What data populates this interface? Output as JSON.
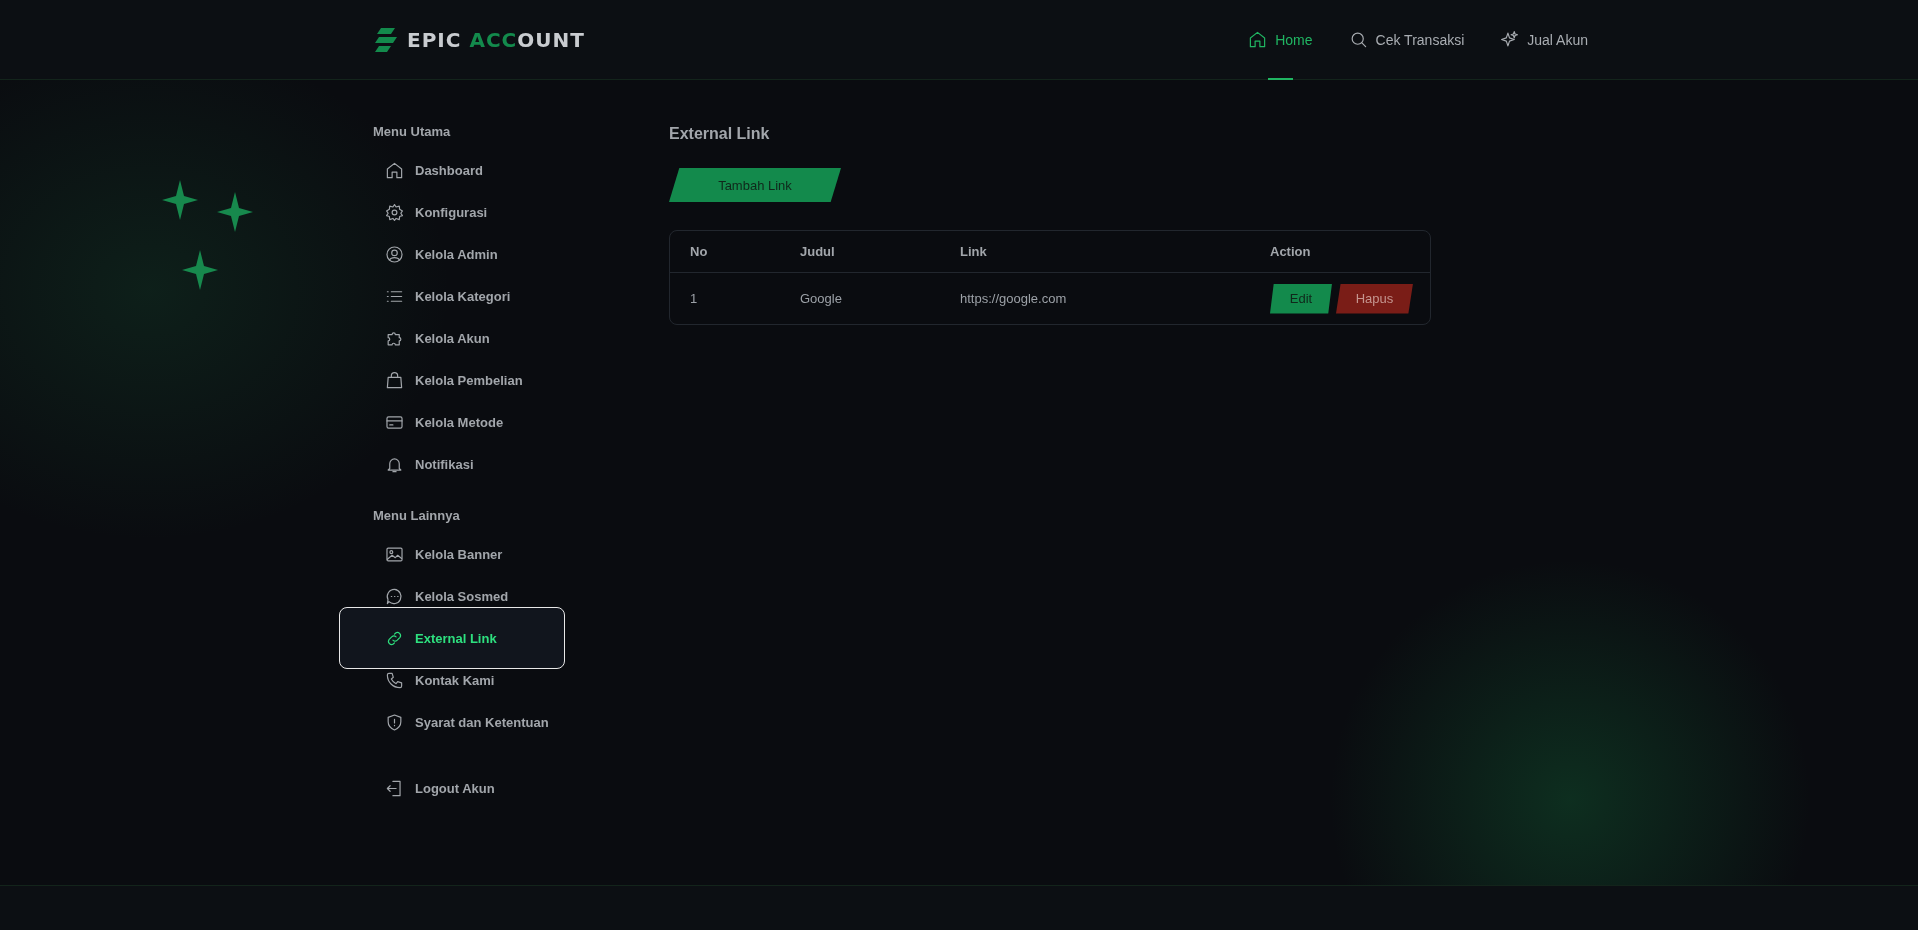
{
  "header": {
    "logo": {
      "start": "EPIC ",
      "accent": "ACC",
      "end": "OUNT"
    },
    "nav": [
      {
        "label": "Home",
        "selected": true
      },
      {
        "label": "Cek Transaksi",
        "selected": false
      },
      {
        "label": "Jual Akun",
        "selected": false
      }
    ]
  },
  "sidebar": {
    "sections": [
      {
        "title": "Menu Utama",
        "items": [
          {
            "label": "Dashboard",
            "selected": false
          },
          {
            "label": "Konfigurasi",
            "selected": false
          },
          {
            "label": "Kelola Admin",
            "selected": false
          },
          {
            "label": "Kelola Kategori",
            "selected": false
          },
          {
            "label": "Kelola Akun",
            "selected": false
          },
          {
            "label": "Kelola Pembelian",
            "selected": false
          },
          {
            "label": "Kelola Metode",
            "selected": false
          },
          {
            "label": "Notifikasi",
            "selected": false
          }
        ]
      },
      {
        "title": "Menu Lainnya",
        "items": [
          {
            "label": "Kelola Banner",
            "selected": false
          },
          {
            "label": "Kelola Sosmed",
            "selected": false
          },
          {
            "label": "External Link",
            "selected": true
          },
          {
            "label": "Kontak Kami",
            "selected": false
          },
          {
            "label": "Syarat dan Ketentuan",
            "selected": false
          }
        ]
      }
    ],
    "logout": {
      "label": "Logout Akun"
    }
  },
  "main": {
    "title": "External Link",
    "add_button": "Tambah Link",
    "table": {
      "columns": [
        "No",
        "Judul",
        "Link",
        "Action"
      ],
      "rows": [
        {
          "cells": [
            "1",
            "Google",
            "https://google.com"
          ],
          "actions": [
            {
              "label": "Edit",
              "kind": "edit"
            },
            {
              "label": "Hapus",
              "kind": "delete"
            }
          ]
        }
      ]
    }
  }
}
